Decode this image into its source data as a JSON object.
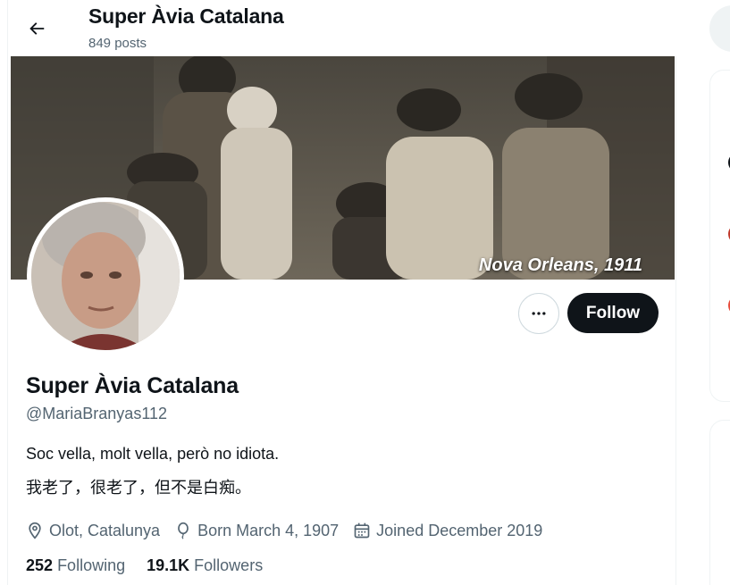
{
  "topbar": {
    "title": "Super Àvia Catalana",
    "posts_count": "849 posts"
  },
  "banner": {
    "caption": "Nova Orleans, 1911"
  },
  "actions": {
    "follow_label": "Follow"
  },
  "profile": {
    "name": "Super Àvia Catalana",
    "handle": "@MariaBranyas112",
    "bio_line1": "Soc vella, molt vella, però no idiota.",
    "bio_line2": "我老了，很老了，但不是白痴。",
    "location": "Olot, Catalunya",
    "born": "Born March 4, 1907",
    "joined": "Joined December 2019",
    "following_count": "252",
    "following_label": "Following",
    "followers_count": "19.1K",
    "followers_label": "Followers"
  },
  "icons": {
    "back": "arrow-left-icon",
    "more": "more-horizontal-icon",
    "location": "map-pin-icon",
    "born": "balloon-icon",
    "joined": "calendar-icon"
  },
  "colors": {
    "text_primary": "#0f1419",
    "text_secondary": "#536471",
    "follow_bg": "#0f1419",
    "border": "#cfd9de"
  }
}
